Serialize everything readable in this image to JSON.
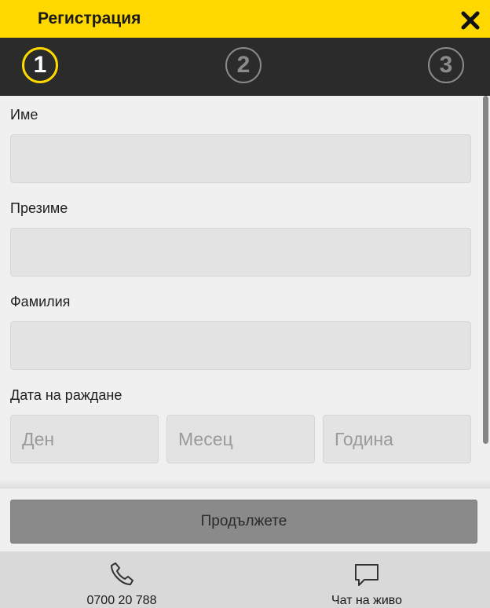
{
  "header": {
    "title": "Регистрация",
    "close_icon": "close-icon",
    "accent_color": "#ffd800"
  },
  "steps": [
    {
      "label": "1",
      "state": "active"
    },
    {
      "label": "2",
      "state": "inactive"
    },
    {
      "label": "3",
      "state": "inactive"
    }
  ],
  "form": {
    "first_name": {
      "label": "Име",
      "value": "",
      "placeholder": ""
    },
    "middle_name": {
      "label": "Презиме",
      "value": "",
      "placeholder": ""
    },
    "last_name": {
      "label": "Фамилия",
      "value": "",
      "placeholder": ""
    },
    "birth_date": {
      "label": "Дата на раждане",
      "day_placeholder": "Ден",
      "month_placeholder": "Месец",
      "year_placeholder": "Година"
    }
  },
  "actions": {
    "continue_label": "Продължете"
  },
  "contacts": {
    "phone": {
      "icon": "phone-icon",
      "label": "0700 20 788"
    },
    "chat": {
      "icon": "chat-bubble-icon",
      "label": "Чат на живо"
    }
  }
}
